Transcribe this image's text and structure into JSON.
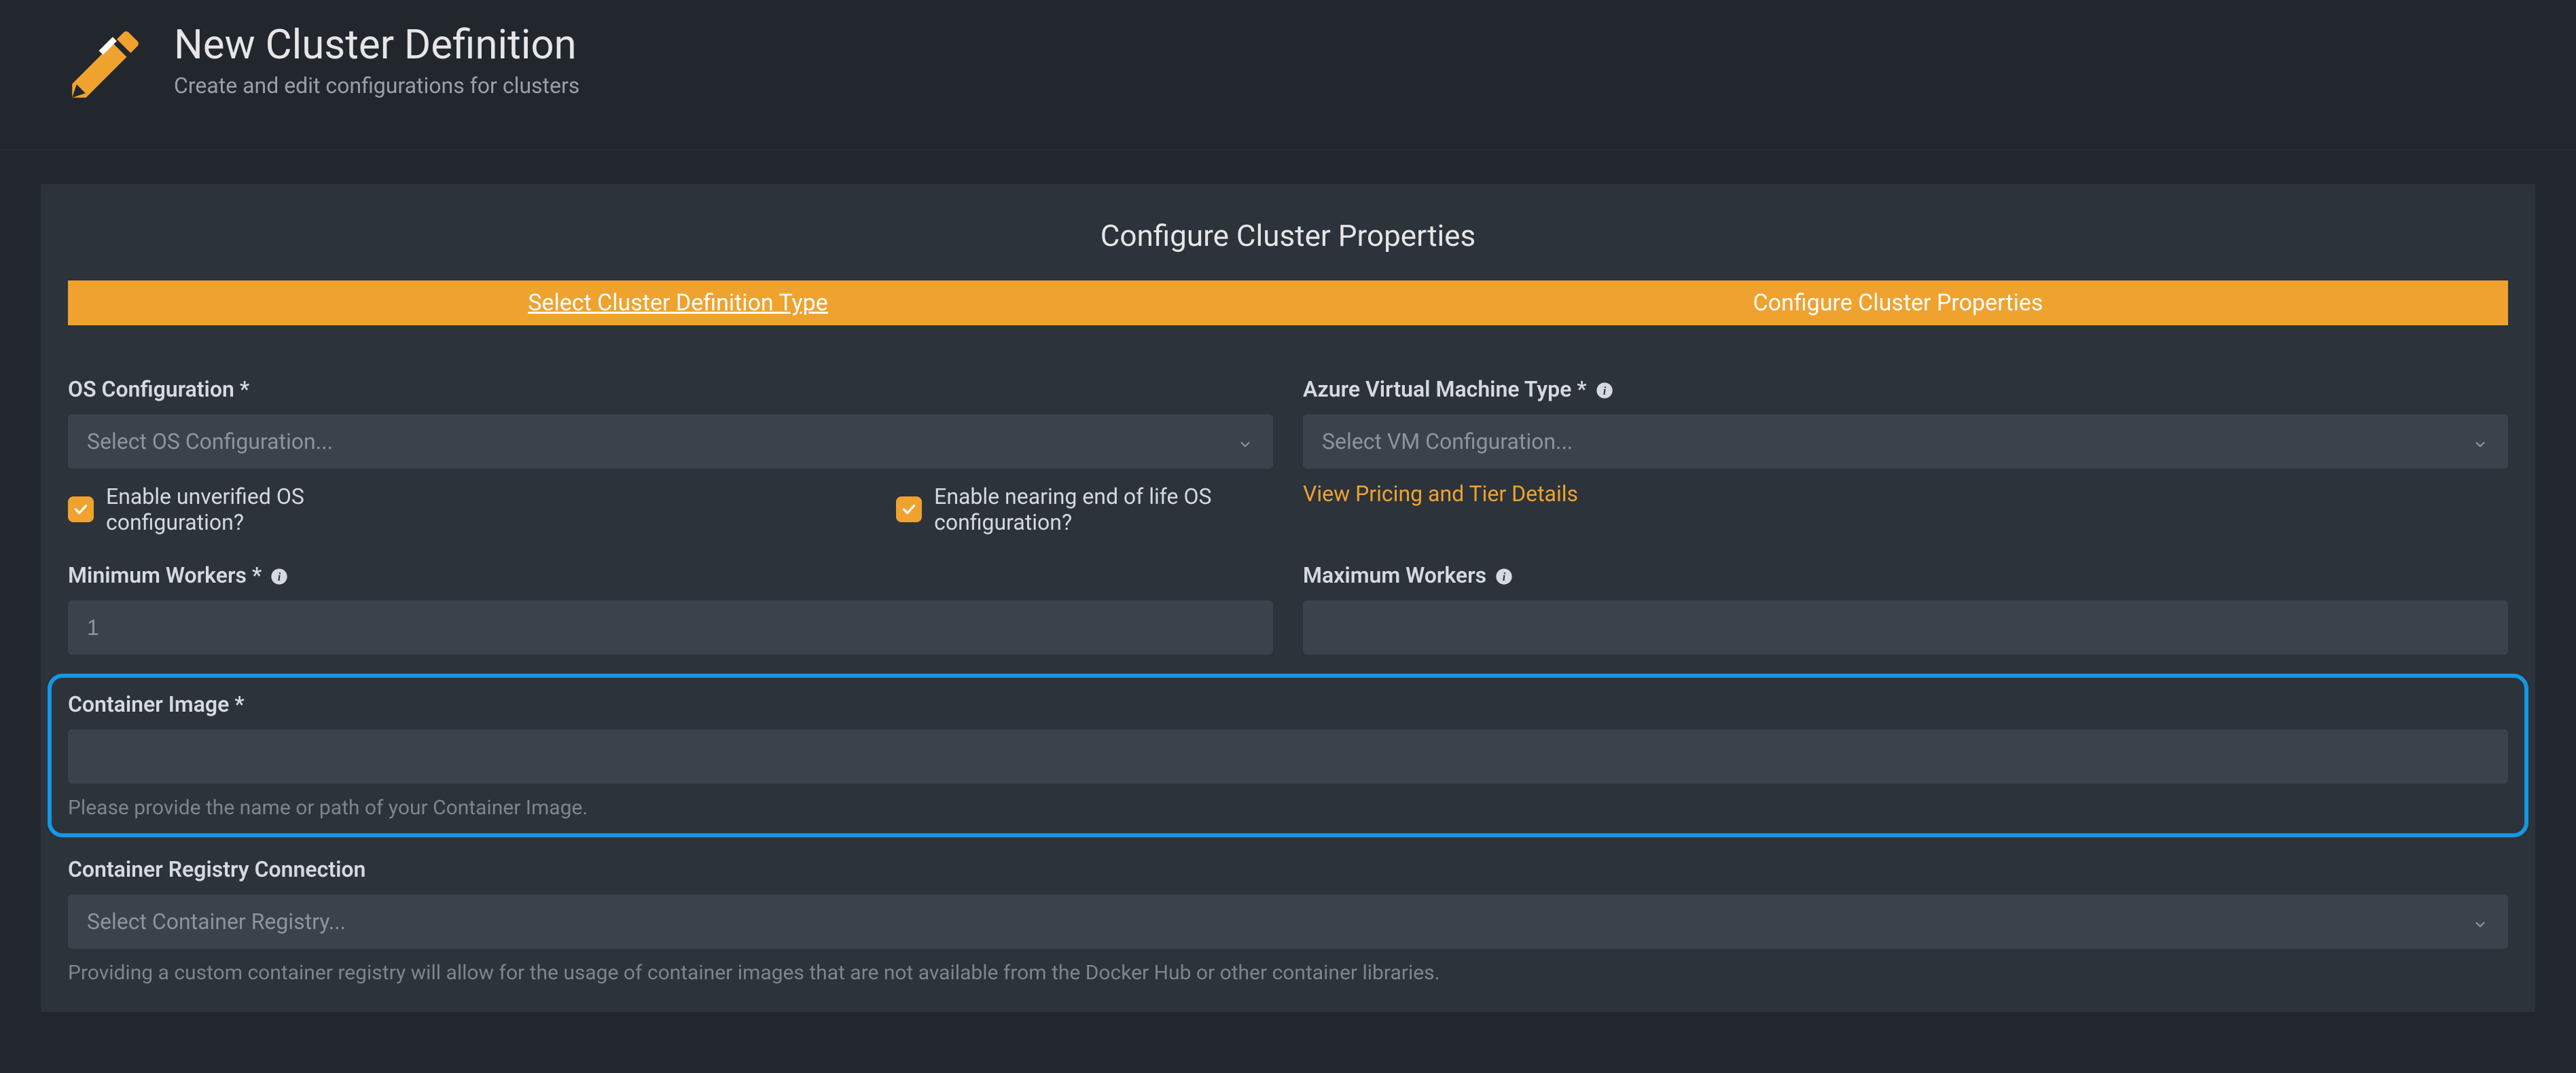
{
  "header": {
    "title": "New Cluster Definition",
    "subtitle": "Create and edit configurations for clusters"
  },
  "panel": {
    "title": "Configure Cluster Properties"
  },
  "tabs": {
    "select_type": "Select Cluster Definition Type",
    "configure": "Configure Cluster Properties"
  },
  "fields": {
    "os_config": {
      "label": "OS Configuration *",
      "placeholder": "Select OS Configuration..."
    },
    "vm_type": {
      "label": "Azure Virtual Machine Type *",
      "placeholder": "Select VM Configuration...",
      "link": "View Pricing and Tier Details"
    },
    "enable_unverified": {
      "label": "Enable unverified OS configuration?"
    },
    "enable_eol": {
      "label": "Enable nearing end of life OS configuration?"
    },
    "min_workers": {
      "label": "Minimum Workers *",
      "placeholder": "1",
      "value": ""
    },
    "max_workers": {
      "label": "Maximum Workers"
    },
    "container_image": {
      "label": "Container Image *",
      "help": "Please provide the name or path of your Container Image."
    },
    "container_registry": {
      "label": "Container Registry Connection",
      "placeholder": "Select Container Registry...",
      "help": "Providing a custom container registry will allow for the usage of container images that are not available from the Docker Hub or other container libraries."
    }
  }
}
